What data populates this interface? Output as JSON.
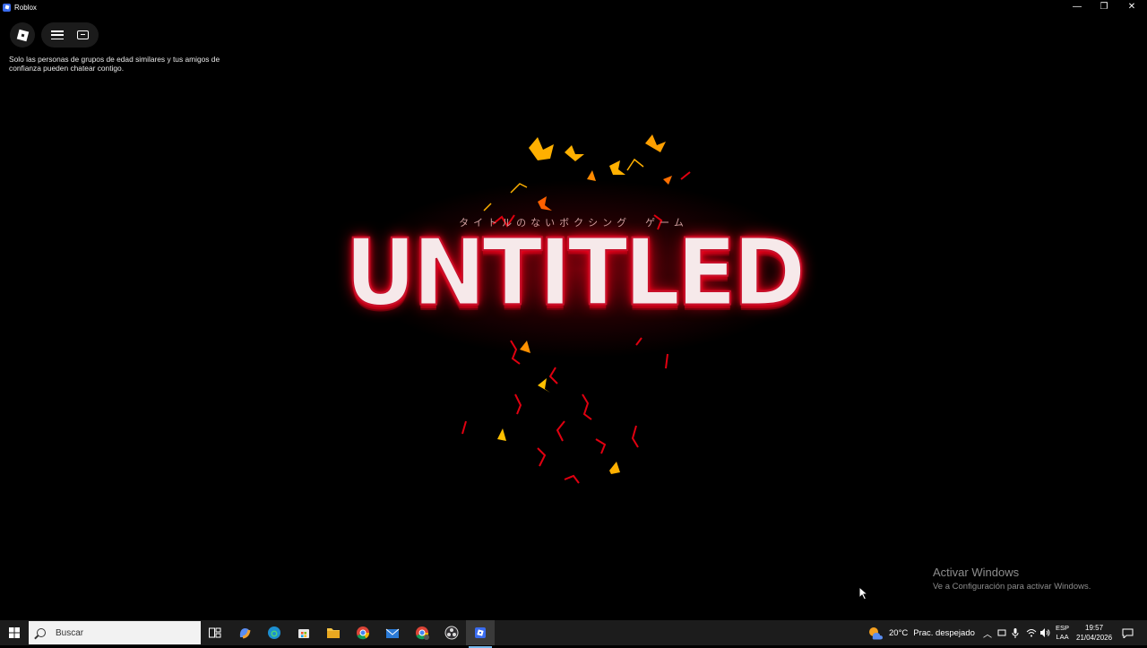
{
  "window": {
    "title": "Roblox",
    "minimize_glyph": "—",
    "restore_glyph": "❐",
    "close_glyph": "✕"
  },
  "roblox_ui": {
    "chat_notice": "Solo las personas de grupos de edad similares y tus amigos de confianza pueden chatear contigo."
  },
  "game": {
    "subtitle_jp": "タイトルのないボクシング　ゲーム",
    "logo_text": "UNTITLED",
    "accent_color": "#e0001a",
    "fire_color": "#ffb000"
  },
  "watermark": {
    "title": "Activar Windows",
    "subtitle": "Ve a Configuración para activar Windows."
  },
  "taskbar": {
    "search_placeholder": "Buscar",
    "weather_temp": "20°C",
    "weather_text": "Prac. despejado",
    "lang_top": "ESP",
    "lang_bottom": "LAA",
    "time": "19:57",
    "date": "21/04/2026",
    "apps": [
      "task-view-icon",
      "copilot-icon",
      "edge-icon",
      "store-icon",
      "file-explorer-icon",
      "chrome-icon",
      "mail-icon",
      "chrome-profile-icon",
      "obs-icon",
      "roblox-icon"
    ]
  }
}
